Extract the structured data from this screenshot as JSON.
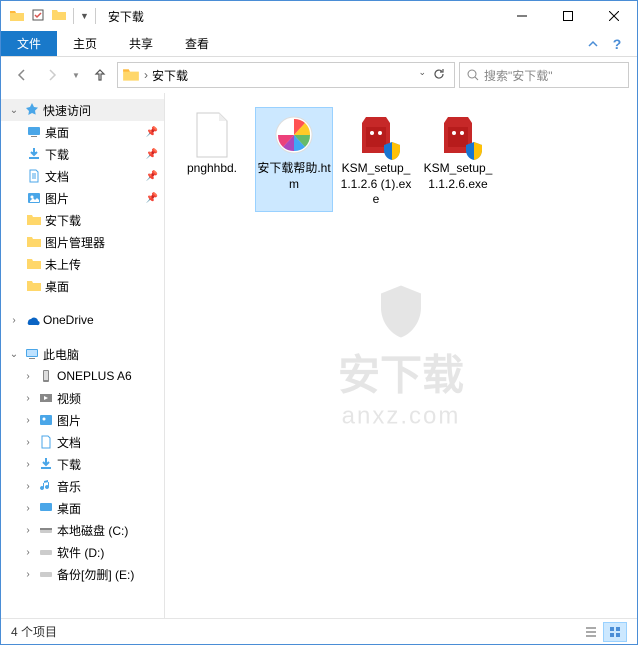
{
  "titlebar": {
    "title": "安下载"
  },
  "ribbon": {
    "file": "文件",
    "home": "主页",
    "share": "共享",
    "view": "查看"
  },
  "breadcrumb": {
    "folder": "安下载"
  },
  "search": {
    "placeholder": "搜索\"安下载\""
  },
  "sidebar": {
    "quick_access": "快速访问",
    "desktop": "桌面",
    "downloads": "下载",
    "documents": "文档",
    "pictures": "图片",
    "anxiazai": "安下载",
    "picmgr": "图片管理器",
    "unuploaded": "未上传",
    "desktop2": "桌面",
    "onedrive": "OneDrive",
    "thispc": "此电脑",
    "oneplus": "ONEPLUS A6",
    "videos": "视频",
    "pictures2": "图片",
    "documents2": "文档",
    "downloads2": "下载",
    "music": "音乐",
    "desktop3": "桌面",
    "localdisk": "本地磁盘 (C:)",
    "software": "软件 (D:)",
    "backup": "备份[勿删] (E:)"
  },
  "files": [
    {
      "name": "pnghhbd.",
      "type": "blank"
    },
    {
      "name": "安下载帮助.htm",
      "type": "htm"
    },
    {
      "name": "KSM_setup_1.1.2.6 (1).exe",
      "type": "exe"
    },
    {
      "name": "KSM_setup_1.1.2.6.exe",
      "type": "exe"
    }
  ],
  "watermark": {
    "line1": "安下载",
    "line2": "anxz.com"
  },
  "statusbar": {
    "count": "4 个项目"
  }
}
